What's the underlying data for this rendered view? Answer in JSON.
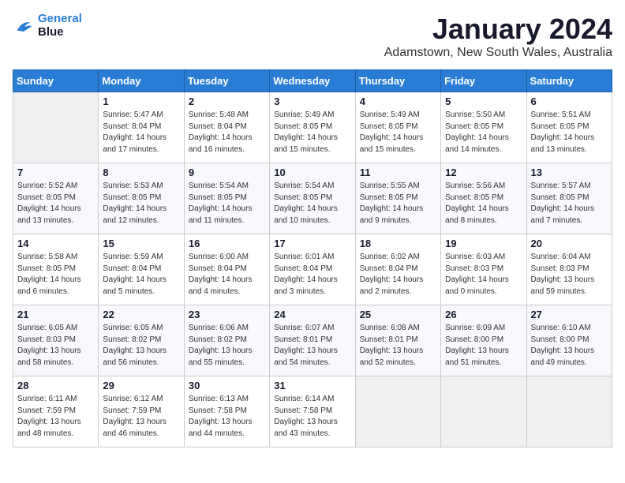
{
  "logo": {
    "line1": "General",
    "line2": "Blue"
  },
  "title": "January 2024",
  "subtitle": "Adamstown, New South Wales, Australia",
  "days_header": [
    "Sunday",
    "Monday",
    "Tuesday",
    "Wednesday",
    "Thursday",
    "Friday",
    "Saturday"
  ],
  "weeks": [
    [
      {
        "num": "",
        "info": ""
      },
      {
        "num": "1",
        "info": "Sunrise: 5:47 AM\nSunset: 8:04 PM\nDaylight: 14 hours\nand 17 minutes."
      },
      {
        "num": "2",
        "info": "Sunrise: 5:48 AM\nSunset: 8:04 PM\nDaylight: 14 hours\nand 16 minutes."
      },
      {
        "num": "3",
        "info": "Sunrise: 5:49 AM\nSunset: 8:05 PM\nDaylight: 14 hours\nand 15 minutes."
      },
      {
        "num": "4",
        "info": "Sunrise: 5:49 AM\nSunset: 8:05 PM\nDaylight: 14 hours\nand 15 minutes."
      },
      {
        "num": "5",
        "info": "Sunrise: 5:50 AM\nSunset: 8:05 PM\nDaylight: 14 hours\nand 14 minutes."
      },
      {
        "num": "6",
        "info": "Sunrise: 5:51 AM\nSunset: 8:05 PM\nDaylight: 14 hours\nand 13 minutes."
      }
    ],
    [
      {
        "num": "7",
        "info": "Sunrise: 5:52 AM\nSunset: 8:05 PM\nDaylight: 14 hours\nand 13 minutes."
      },
      {
        "num": "8",
        "info": "Sunrise: 5:53 AM\nSunset: 8:05 PM\nDaylight: 14 hours\nand 12 minutes."
      },
      {
        "num": "9",
        "info": "Sunrise: 5:54 AM\nSunset: 8:05 PM\nDaylight: 14 hours\nand 11 minutes."
      },
      {
        "num": "10",
        "info": "Sunrise: 5:54 AM\nSunset: 8:05 PM\nDaylight: 14 hours\nand 10 minutes."
      },
      {
        "num": "11",
        "info": "Sunrise: 5:55 AM\nSunset: 8:05 PM\nDaylight: 14 hours\nand 9 minutes."
      },
      {
        "num": "12",
        "info": "Sunrise: 5:56 AM\nSunset: 8:05 PM\nDaylight: 14 hours\nand 8 minutes."
      },
      {
        "num": "13",
        "info": "Sunrise: 5:57 AM\nSunset: 8:05 PM\nDaylight: 14 hours\nand 7 minutes."
      }
    ],
    [
      {
        "num": "14",
        "info": "Sunrise: 5:58 AM\nSunset: 8:05 PM\nDaylight: 14 hours\nand 6 minutes."
      },
      {
        "num": "15",
        "info": "Sunrise: 5:59 AM\nSunset: 8:04 PM\nDaylight: 14 hours\nand 5 minutes."
      },
      {
        "num": "16",
        "info": "Sunrise: 6:00 AM\nSunset: 8:04 PM\nDaylight: 14 hours\nand 4 minutes."
      },
      {
        "num": "17",
        "info": "Sunrise: 6:01 AM\nSunset: 8:04 PM\nDaylight: 14 hours\nand 3 minutes."
      },
      {
        "num": "18",
        "info": "Sunrise: 6:02 AM\nSunset: 8:04 PM\nDaylight: 14 hours\nand 2 minutes."
      },
      {
        "num": "19",
        "info": "Sunrise: 6:03 AM\nSunset: 8:03 PM\nDaylight: 14 hours\nand 0 minutes."
      },
      {
        "num": "20",
        "info": "Sunrise: 6:04 AM\nSunset: 8:03 PM\nDaylight: 13 hours\nand 59 minutes."
      }
    ],
    [
      {
        "num": "21",
        "info": "Sunrise: 6:05 AM\nSunset: 8:03 PM\nDaylight: 13 hours\nand 58 minutes."
      },
      {
        "num": "22",
        "info": "Sunrise: 6:05 AM\nSunset: 8:02 PM\nDaylight: 13 hours\nand 56 minutes."
      },
      {
        "num": "23",
        "info": "Sunrise: 6:06 AM\nSunset: 8:02 PM\nDaylight: 13 hours\nand 55 minutes."
      },
      {
        "num": "24",
        "info": "Sunrise: 6:07 AM\nSunset: 8:01 PM\nDaylight: 13 hours\nand 54 minutes."
      },
      {
        "num": "25",
        "info": "Sunrise: 6:08 AM\nSunset: 8:01 PM\nDaylight: 13 hours\nand 52 minutes."
      },
      {
        "num": "26",
        "info": "Sunrise: 6:09 AM\nSunset: 8:00 PM\nDaylight: 13 hours\nand 51 minutes."
      },
      {
        "num": "27",
        "info": "Sunrise: 6:10 AM\nSunset: 8:00 PM\nDaylight: 13 hours\nand 49 minutes."
      }
    ],
    [
      {
        "num": "28",
        "info": "Sunrise: 6:11 AM\nSunset: 7:59 PM\nDaylight: 13 hours\nand 48 minutes."
      },
      {
        "num": "29",
        "info": "Sunrise: 6:12 AM\nSunset: 7:59 PM\nDaylight: 13 hours\nand 46 minutes."
      },
      {
        "num": "30",
        "info": "Sunrise: 6:13 AM\nSunset: 7:58 PM\nDaylight: 13 hours\nand 44 minutes."
      },
      {
        "num": "31",
        "info": "Sunrise: 6:14 AM\nSunset: 7:58 PM\nDaylight: 13 hours\nand 43 minutes."
      },
      {
        "num": "",
        "info": ""
      },
      {
        "num": "",
        "info": ""
      },
      {
        "num": "",
        "info": ""
      }
    ]
  ]
}
